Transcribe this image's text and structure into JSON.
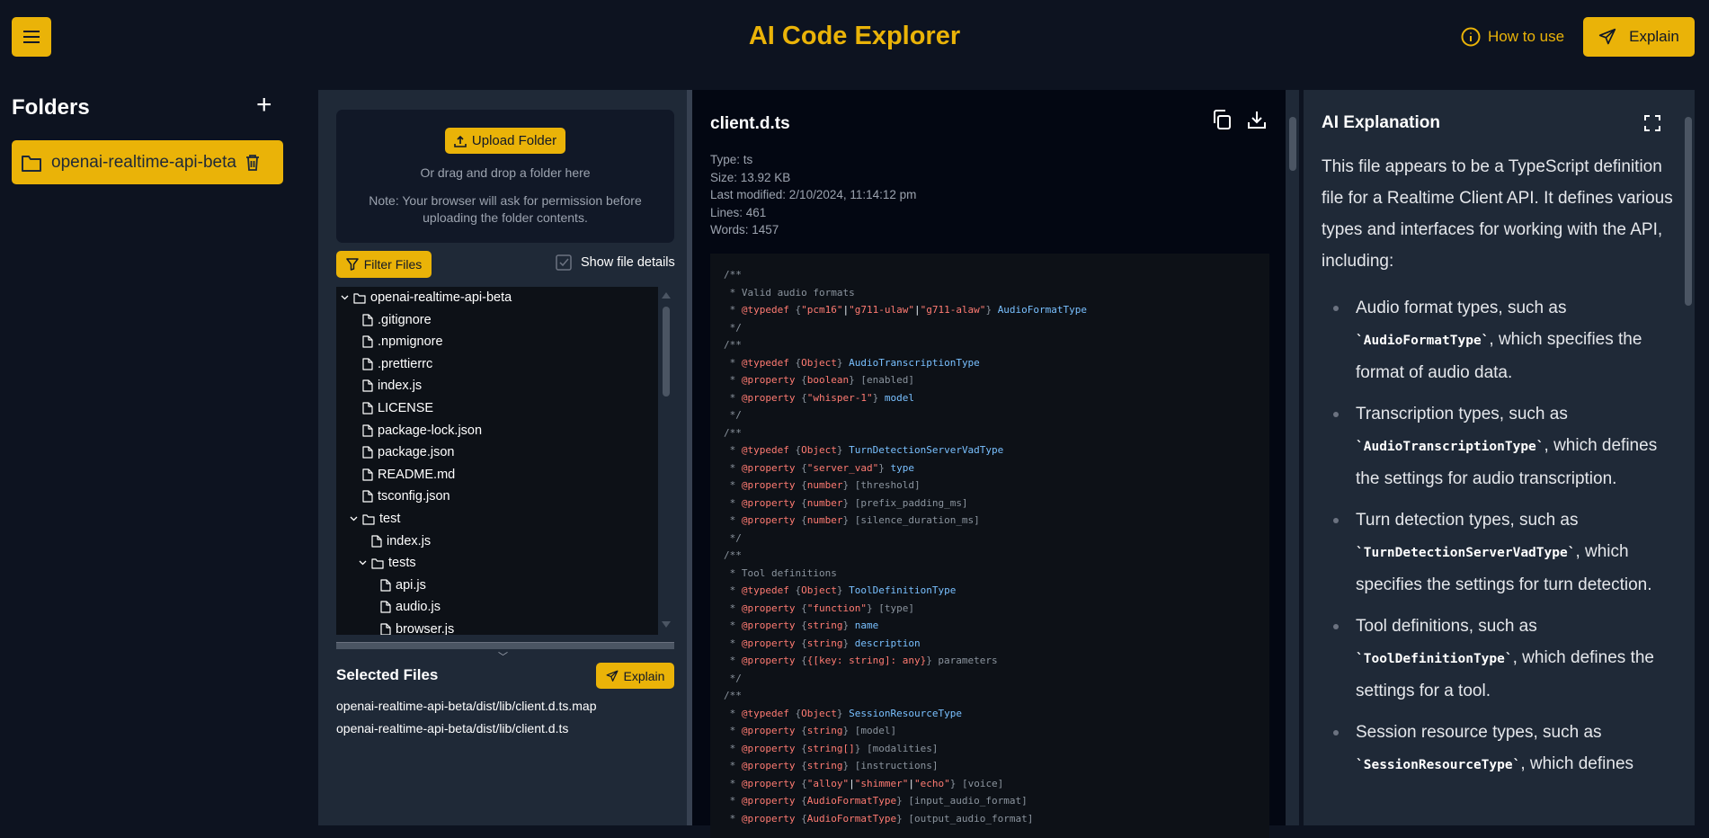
{
  "header": {
    "title": "AI Code Explorer",
    "how_to_use": "How to use",
    "explain": "Explain",
    "accent": "#eab308"
  },
  "sidebar": {
    "heading": "Folders",
    "folders": [
      {
        "name": "openai-realtime-api-beta"
      }
    ]
  },
  "upload": {
    "button": "Upload Folder",
    "drag_text": "Or drag and drop a folder here",
    "note": "Note: Your browser will ask for permission before uploading the folder contents."
  },
  "filter": {
    "button": "Filter Files",
    "show_details_label": "Show file details",
    "show_details_checked": true
  },
  "tree": [
    {
      "name": "openai-realtime-api-beta",
      "type": "folder",
      "depth": 0,
      "expanded": true
    },
    {
      "name": ".gitignore",
      "type": "file",
      "depth": 1
    },
    {
      "name": ".npmignore",
      "type": "file",
      "depth": 1
    },
    {
      "name": ".prettierrc",
      "type": "file",
      "depth": 1
    },
    {
      "name": "index.js",
      "type": "file",
      "depth": 1
    },
    {
      "name": "LICENSE",
      "type": "file",
      "depth": 1
    },
    {
      "name": "package-lock.json",
      "type": "file",
      "depth": 1
    },
    {
      "name": "package.json",
      "type": "file",
      "depth": 1
    },
    {
      "name": "README.md",
      "type": "file",
      "depth": 1
    },
    {
      "name": "tsconfig.json",
      "type": "file",
      "depth": 1
    },
    {
      "name": "test",
      "type": "folder",
      "depth": 1,
      "expanded": true
    },
    {
      "name": "index.js",
      "type": "file",
      "depth": 2
    },
    {
      "name": "tests",
      "type": "folder",
      "depth": 2,
      "expanded": true
    },
    {
      "name": "api.js",
      "type": "file",
      "depth": 3
    },
    {
      "name": "audio.js",
      "type": "file",
      "depth": 3
    },
    {
      "name": "browser.js",
      "type": "file",
      "depth": 3
    }
  ],
  "selected": {
    "heading": "Selected Files",
    "explain": "Explain",
    "files": [
      "openai-realtime-api-beta/dist/lib/client.d.ts.map",
      "openai-realtime-api-beta/dist/lib/client.d.ts"
    ]
  },
  "file": {
    "name": "client.d.ts",
    "meta": [
      "Type: ts",
      "Size: 13.92 KB",
      "Last modified: 2/10/2024, 11:14:12 pm",
      "Lines: 461",
      "Words: 1457"
    ]
  },
  "code": [
    [
      [
        "c",
        "/**"
      ]
    ],
    [
      [
        "c",
        " * Valid audio formats"
      ]
    ],
    [
      [
        "c",
        " * "
      ],
      [
        "k",
        "@typedef"
      ],
      [
        "c",
        " {"
      ],
      [
        "k",
        "\"pcm16\""
      ],
      [
        "w",
        "|"
      ],
      [
        "k",
        "\"g711-ulaw\""
      ],
      [
        "w",
        "|"
      ],
      [
        "k",
        "\"g711-alaw\""
      ],
      [
        "c",
        "} "
      ],
      [
        "b",
        "AudioFormatType"
      ]
    ],
    [
      [
        "c",
        " */"
      ]
    ],
    [
      [
        "c",
        "/**"
      ]
    ],
    [
      [
        "c",
        " * "
      ],
      [
        "k",
        "@typedef"
      ],
      [
        "c",
        " {"
      ],
      [
        "k",
        "Object"
      ],
      [
        "c",
        "} "
      ],
      [
        "b",
        "AudioTranscriptionType"
      ]
    ],
    [
      [
        "c",
        " * "
      ],
      [
        "k",
        "@property"
      ],
      [
        "c",
        " {"
      ],
      [
        "k",
        "boolean"
      ],
      [
        "c",
        "} [enabled]"
      ]
    ],
    [
      [
        "c",
        " * "
      ],
      [
        "k",
        "@property"
      ],
      [
        "c",
        " {"
      ],
      [
        "k",
        "\"whisper-1\""
      ],
      [
        "c",
        "} "
      ],
      [
        "b",
        "model"
      ]
    ],
    [
      [
        "c",
        " */"
      ]
    ],
    [
      [
        "c",
        "/**"
      ]
    ],
    [
      [
        "c",
        " * "
      ],
      [
        "k",
        "@typedef"
      ],
      [
        "c",
        " {"
      ],
      [
        "k",
        "Object"
      ],
      [
        "c",
        "} "
      ],
      [
        "b",
        "TurnDetectionServerVadType"
      ]
    ],
    [
      [
        "c",
        " * "
      ],
      [
        "k",
        "@property"
      ],
      [
        "c",
        " {"
      ],
      [
        "k",
        "\"server_vad\""
      ],
      [
        "c",
        "} "
      ],
      [
        "b",
        "type"
      ]
    ],
    [
      [
        "c",
        " * "
      ],
      [
        "k",
        "@property"
      ],
      [
        "c",
        " {"
      ],
      [
        "k",
        "number"
      ],
      [
        "c",
        "} [threshold]"
      ]
    ],
    [
      [
        "c",
        " * "
      ],
      [
        "k",
        "@property"
      ],
      [
        "c",
        " {"
      ],
      [
        "k",
        "number"
      ],
      [
        "c",
        "} [prefix_padding_ms]"
      ]
    ],
    [
      [
        "c",
        " * "
      ],
      [
        "k",
        "@property"
      ],
      [
        "c",
        " {"
      ],
      [
        "k",
        "number"
      ],
      [
        "c",
        "} [silence_duration_ms]"
      ]
    ],
    [
      [
        "c",
        " */"
      ]
    ],
    [
      [
        "c",
        "/**"
      ]
    ],
    [
      [
        "c",
        " * Tool definitions"
      ]
    ],
    [
      [
        "c",
        " * "
      ],
      [
        "k",
        "@typedef"
      ],
      [
        "c",
        " {"
      ],
      [
        "k",
        "Object"
      ],
      [
        "c",
        "} "
      ],
      [
        "b",
        "ToolDefinitionType"
      ]
    ],
    [
      [
        "c",
        " * "
      ],
      [
        "k",
        "@property"
      ],
      [
        "c",
        " {"
      ],
      [
        "k",
        "\"function\""
      ],
      [
        "c",
        "} [type]"
      ]
    ],
    [
      [
        "c",
        " * "
      ],
      [
        "k",
        "@property"
      ],
      [
        "c",
        " {"
      ],
      [
        "k",
        "string"
      ],
      [
        "c",
        "} "
      ],
      [
        "b",
        "name"
      ]
    ],
    [
      [
        "c",
        " * "
      ],
      [
        "k",
        "@property"
      ],
      [
        "c",
        " {"
      ],
      [
        "k",
        "string"
      ],
      [
        "c",
        "} "
      ],
      [
        "b",
        "description"
      ]
    ],
    [
      [
        "c",
        " * "
      ],
      [
        "k",
        "@property"
      ],
      [
        "c",
        " {"
      ],
      [
        "k",
        "{[key: string]: any}"
      ],
      [
        "c",
        "} parameters"
      ]
    ],
    [
      [
        "c",
        " */"
      ]
    ],
    [
      [
        "c",
        "/**"
      ]
    ],
    [
      [
        "c",
        " * "
      ],
      [
        "k",
        "@typedef"
      ],
      [
        "c",
        " {"
      ],
      [
        "k",
        "Object"
      ],
      [
        "c",
        "} "
      ],
      [
        "b",
        "SessionResourceType"
      ]
    ],
    [
      [
        "c",
        " * "
      ],
      [
        "k",
        "@property"
      ],
      [
        "c",
        " {"
      ],
      [
        "k",
        "string"
      ],
      [
        "c",
        "} [model]"
      ]
    ],
    [
      [
        "c",
        " * "
      ],
      [
        "k",
        "@property"
      ],
      [
        "c",
        " {"
      ],
      [
        "k",
        "string[]"
      ],
      [
        "c",
        "} [modalities]"
      ]
    ],
    [
      [
        "c",
        " * "
      ],
      [
        "k",
        "@property"
      ],
      [
        "c",
        " {"
      ],
      [
        "k",
        "string"
      ],
      [
        "c",
        "} [instructions]"
      ]
    ],
    [
      [
        "c",
        " * "
      ],
      [
        "k",
        "@property"
      ],
      [
        "c",
        " {"
      ],
      [
        "k",
        "\"alloy\""
      ],
      [
        "w",
        "|"
      ],
      [
        "k",
        "\"shimmer\""
      ],
      [
        "w",
        "|"
      ],
      [
        "k",
        "\"echo\""
      ],
      [
        "c",
        "} [voice]"
      ]
    ],
    [
      [
        "c",
        " * "
      ],
      [
        "k",
        "@property"
      ],
      [
        "c",
        " {"
      ],
      [
        "k",
        "AudioFormatType"
      ],
      [
        "c",
        "} [input_audio_format]"
      ]
    ],
    [
      [
        "c",
        " * "
      ],
      [
        "k",
        "@property"
      ],
      [
        "c",
        " {"
      ],
      [
        "k",
        "AudioFormatType"
      ],
      [
        "c",
        "} [output_audio_format]"
      ]
    ]
  ],
  "ai": {
    "heading": "AI Explanation",
    "intro": "This file appears to be a TypeScript definition file for a Realtime Client API. It defines various types and interfaces for working with the API, including:",
    "bullets": [
      {
        "pre": "Audio format types, such as ",
        "code": "`AudioFormatType`",
        "post": ", which specifies the format of audio data."
      },
      {
        "pre": "Transcription types, such as ",
        "code": "`AudioTranscriptionType`",
        "post": ", which defines the settings for audio transcription."
      },
      {
        "pre": "Turn detection types, such as ",
        "code": "`TurnDetectionServerVadType`",
        "post": ", which specifies the settings for turn detection."
      },
      {
        "pre": "Tool definitions, such as ",
        "code": "`ToolDefinitionType`",
        "post": ", which defines the settings for a tool."
      },
      {
        "pre": "Session resource types, such as ",
        "code": "`SessionResourceType`",
        "post": ", which defines"
      }
    ]
  }
}
